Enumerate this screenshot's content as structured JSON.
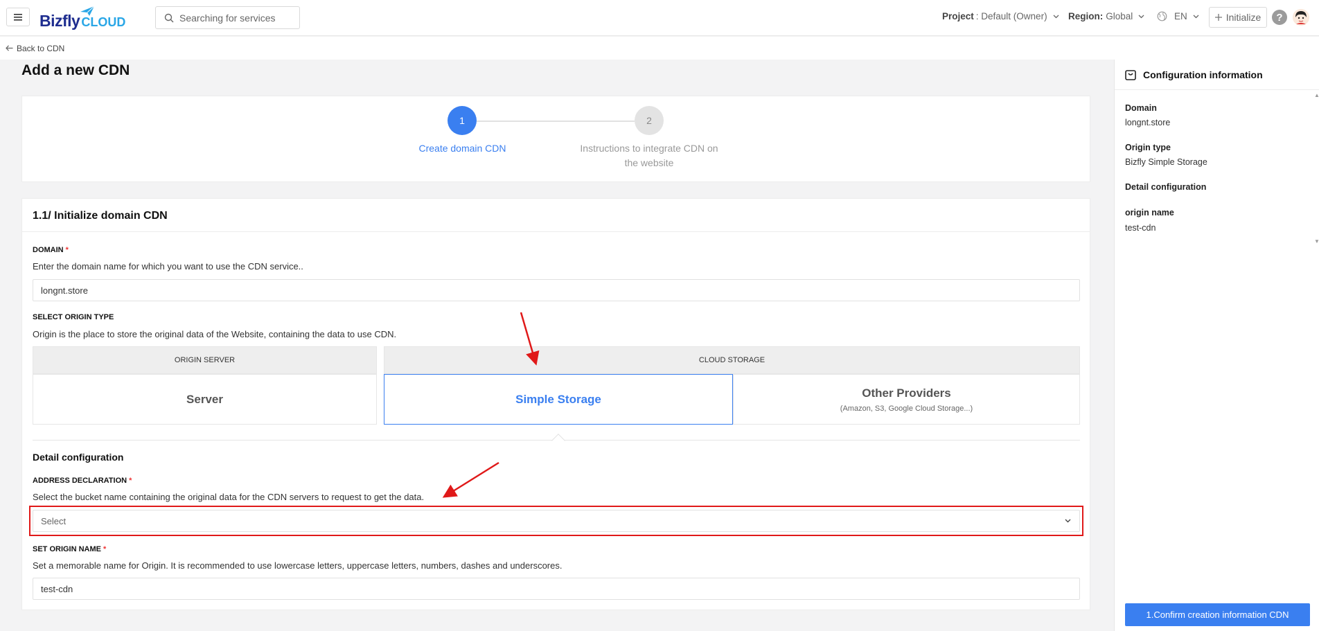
{
  "header": {
    "brand": "Bizfly",
    "brand_suffix": "CLOUD",
    "search_placeholder": "Searching for services",
    "project_label": "Project",
    "project_value": ": Default (Owner)",
    "region_label": "Region:",
    "region_value": "Global",
    "language": "EN",
    "initialize_label": "Initialize",
    "help_glyph": "?"
  },
  "back_link": "Back to CDN",
  "page_title": "Add a new CDN",
  "steps": [
    {
      "number": "1",
      "label": "Create domain CDN",
      "active": true
    },
    {
      "number": "2",
      "label": "Instructions to integrate CDN on the website",
      "active": false
    }
  ],
  "form": {
    "section_title": "1.1/ Initialize domain CDN",
    "domain": {
      "label": "DOMAIN",
      "required_mark": "*",
      "description": "Enter the domain name for which you want to use the CDN service..",
      "value": "longnt.store"
    },
    "origin_type": {
      "label": "SELECT ORIGIN TYPE",
      "description": "Origin is the place to store the original data of the Website, containing the data to use CDN.",
      "groups": [
        {
          "header": "ORIGIN SERVER",
          "options": [
            {
              "title": "Server",
              "sub": ""
            }
          ]
        },
        {
          "header": "CLOUD STORAGE",
          "options": [
            {
              "title": "Simple Storage",
              "sub": "",
              "selected": true
            },
            {
              "title": "Other Providers",
              "sub": "(Amazon, S3, Google Cloud Storage...)"
            }
          ]
        }
      ]
    },
    "detail_title": "Detail configuration",
    "address": {
      "label": "ADDRESS DECLARATION",
      "required_mark": "*",
      "description": "Select the bucket name containing the original data for the CDN servers to request to get the data.",
      "placeholder": "Select"
    },
    "origin_name": {
      "label": "SET ORIGIN NAME",
      "required_mark": "*",
      "description": "Set a memorable name for Origin. It is recommended to use lowercase letters, uppercase letters, numbers, dashes and underscores.",
      "value": "test-cdn"
    }
  },
  "side_panel": {
    "title": "Configuration information",
    "items": [
      {
        "key": "Domain",
        "value": "longnt.store"
      },
      {
        "key": "Origin type",
        "value": "Bizfly Simple Storage"
      },
      {
        "key": "Detail configuration",
        "value": ""
      },
      {
        "key": "origin name",
        "value": "test-cdn"
      }
    ],
    "confirm_label": "1.Confirm creation information CDN"
  },
  "colors": {
    "primary": "#3a7ff0",
    "annotation": "#e01919"
  }
}
